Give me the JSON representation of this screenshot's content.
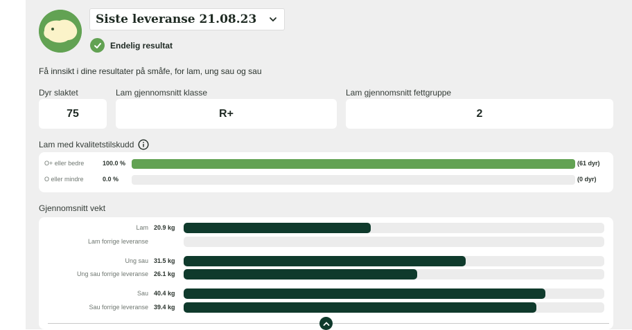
{
  "header": {
    "delivery_title": "Siste leveranse 21.08.23",
    "status_label": "Endelig resultat",
    "intro": "Få innsikt i dine resultater på småfe, for lam, ung sau og sau"
  },
  "stats": [
    {
      "label": "Dyr slaktet",
      "value": "75"
    },
    {
      "label": "Lam gjennomsnitt klasse",
      "value": "R+"
    },
    {
      "label": "Lam gjennomsnitt fettgruppe",
      "value": "2"
    }
  ],
  "quality": {
    "title": "Lam med kvalitetstilskudd",
    "rows": [
      {
        "name": "O+ eller bedre",
        "percent_label": "100.0 %",
        "fraction": 1.0,
        "count": "(61 dyr)"
      },
      {
        "name": "O eller mindre",
        "percent_label": "0.0 %",
        "fraction": 0.0,
        "count": "(0 dyr)"
      }
    ]
  },
  "weight": {
    "title": "Gjennomsnitt vekt",
    "max_kg": 47,
    "rows": [
      {
        "name": "Lam",
        "value_label": "20.9 kg",
        "kg": 20.9
      },
      {
        "name": "Lam forrige leveranse",
        "value_label": "",
        "kg": 0
      },
      {
        "name": "Ung sau",
        "value_label": "31.5 kg",
        "kg": 31.5
      },
      {
        "name": "Ung sau forrige leveranse",
        "value_label": "26.1 kg",
        "kg": 26.1
      },
      {
        "name": "Sau",
        "value_label": "40.4 kg",
        "kg": 40.4
      },
      {
        "name": "Sau forrige leveranse",
        "value_label": "39.4 kg",
        "kg": 39.4
      }
    ]
  },
  "colors": {
    "accent_green": "#62a253",
    "bar_dark": "#0f3a2c",
    "panel_bg": "#efefef"
  },
  "icons": {
    "avatar": "sheep-avatar-icon",
    "dropdown": "chevron-down-icon",
    "status": "check-circle-icon",
    "info": "info-icon",
    "collapse": "chevron-up-icon"
  }
}
